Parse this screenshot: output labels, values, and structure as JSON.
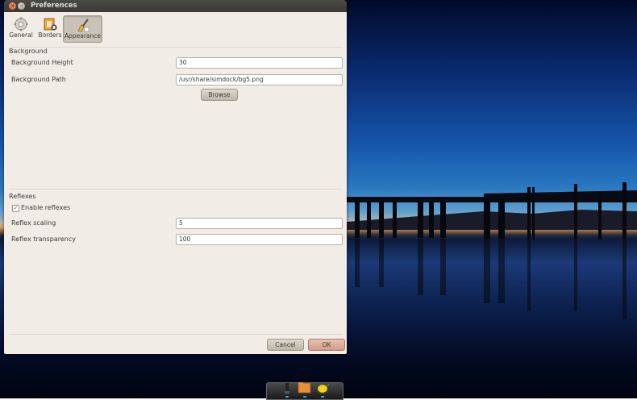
{
  "window": {
    "title": "Preferences"
  },
  "tabs": [
    {
      "label": "General"
    },
    {
      "label": "Borders"
    },
    {
      "label": "Appearance",
      "selected": true
    }
  ],
  "background": {
    "section_title": "Background",
    "height_label": "Background Height",
    "height_value": "30",
    "path_label": "Background Path",
    "path_value": "/usr/share/simdock/bg5.png",
    "browse_label": "Browse"
  },
  "reflexes": {
    "section_title": "Reflexes",
    "enable_label": "Enable reflexes",
    "enable_checked": true,
    "scaling_label": "Reflex scaling",
    "scaling_value": "5",
    "transparency_label": "Reflex transparency",
    "transparency_value": "100"
  },
  "footer": {
    "cancel_label": "Cancel",
    "ok_label": "OK"
  },
  "colors": {
    "window_bg": "#f1ede6",
    "titlebar": "#3a3935",
    "close_button": "#d9532a",
    "ok_button": "#cf9c88",
    "checkbox_mark": "#c43d1e"
  }
}
